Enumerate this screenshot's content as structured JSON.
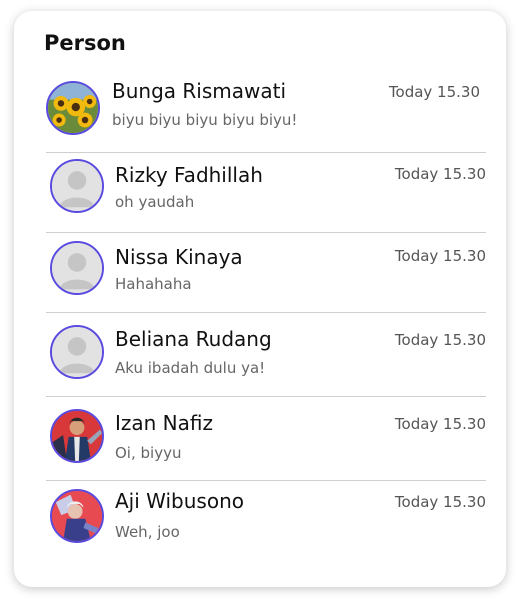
{
  "header": {
    "title": "Person"
  },
  "contacts": [
    {
      "name": "Bunga Rismawati",
      "message": "biyu biyu biyu biyu biyu!",
      "time": "Today 15.30",
      "avatar": "sunflower-avatar"
    },
    {
      "name": "Rizky Fadhillah",
      "message": "oh yaudah",
      "time": "Today 15.30",
      "avatar": "default-user-avatar"
    },
    {
      "name": "Nissa Kinaya",
      "message": "Hahahaha",
      "time": "Today 15.30",
      "avatar": "default-user-avatar"
    },
    {
      "name": "Beliana Rudang",
      "message": "Aku ibadah dulu ya!",
      "time": "Today 15.30",
      "avatar": "default-user-avatar"
    },
    {
      "name": "Izan Nafiz",
      "message": "Oi, biyyu",
      "time": "Today 15.30",
      "avatar": "game-character-avatar"
    },
    {
      "name": "Aji Wibusono",
      "message": "Weh, joo",
      "time": "Today 15.30",
      "avatar": "game-character-avatar"
    }
  ],
  "colors": {
    "avatar_ring": "#5a4be0",
    "separator": "#cfcfcf"
  }
}
